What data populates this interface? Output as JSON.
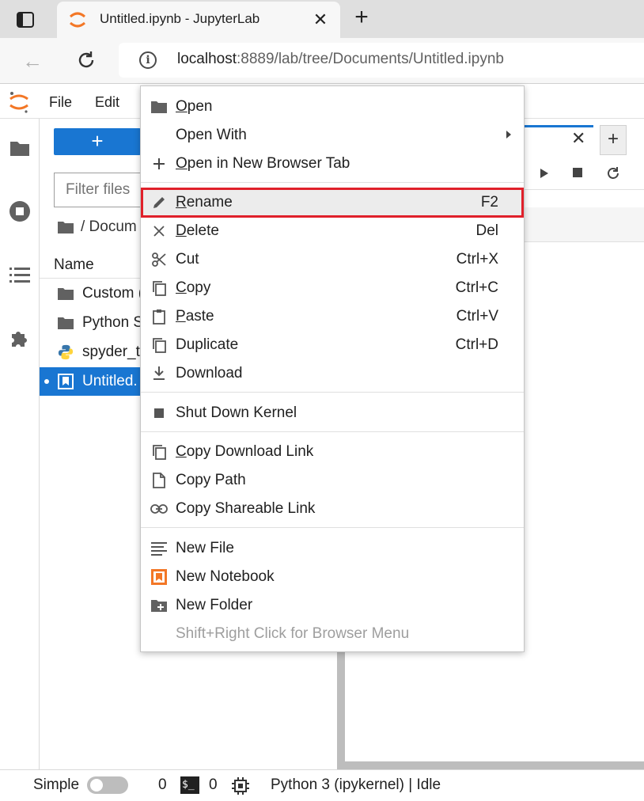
{
  "browser": {
    "tab_title": "Untitled.ipynb - JupyterLab",
    "tab_close": "✕",
    "new_tab": "+",
    "url_host": "localhost",
    "url_rest": ":8889/lab/tree/Documents/Untitled.ipynb",
    "back_label": "←"
  },
  "menubar": {
    "items": [
      "File",
      "Edit"
    ]
  },
  "filebrowser": {
    "new_button": "+",
    "filter_placeholder": "Filter files",
    "breadcrumb": "/ Docum",
    "column_name": "Name",
    "files": [
      {
        "name": "Custom (",
        "icon": "folder-icon"
      },
      {
        "name": "Python S",
        "icon": "folder-icon"
      },
      {
        "name": "spyder_t",
        "icon": "python-file-icon"
      },
      {
        "name": "Untitled.",
        "icon": "notebook-icon",
        "selected": true
      }
    ]
  },
  "dock": {
    "tab_close": "✕",
    "add": "+"
  },
  "context_menu": {
    "items": [
      {
        "icon": "folder-icon",
        "pre": "",
        "u": "O",
        "post": "pen",
        "shortcut": ""
      },
      {
        "icon": "",
        "pre": "Open With",
        "u": "",
        "post": "",
        "shortcut": "",
        "submenu": true
      },
      {
        "icon": "plus-icon",
        "pre": "",
        "u": "O",
        "post": "pen in New Browser Tab",
        "shortcut": ""
      },
      {
        "icon": "pencil-icon",
        "pre": "",
        "u": "R",
        "post": "ename",
        "shortcut": "F2"
      },
      {
        "icon": "close-icon",
        "pre": "",
        "u": "D",
        "post": "elete",
        "shortcut": "Del"
      },
      {
        "icon": "scissors-icon",
        "pre": "Cut",
        "u": "",
        "post": "",
        "shortcut": "Ctrl+X"
      },
      {
        "icon": "copy-icon",
        "pre": "",
        "u": "C",
        "post": "opy",
        "shortcut": "Ctrl+C"
      },
      {
        "icon": "paste-icon",
        "pre": "",
        "u": "P",
        "post": "aste",
        "shortcut": "Ctrl+V"
      },
      {
        "icon": "duplicate-icon",
        "pre": "Duplicate",
        "u": "",
        "post": "",
        "shortcut": "Ctrl+D"
      },
      {
        "icon": "download-icon",
        "pre": "Download",
        "u": "",
        "post": "",
        "shortcut": ""
      },
      {
        "icon": "stop-icon",
        "pre": "Shut Down Kernel",
        "u": "",
        "post": "",
        "shortcut": ""
      },
      {
        "icon": "copy-icon",
        "pre": "",
        "u": "C",
        "post": "opy Download Link",
        "shortcut": ""
      },
      {
        "icon": "file-icon",
        "pre": "Copy Path",
        "u": "",
        "post": "",
        "shortcut": ""
      },
      {
        "icon": "link-icon",
        "pre": "Copy Shareable Link",
        "u": "",
        "post": "",
        "shortcut": ""
      },
      {
        "icon": "text-file-icon",
        "pre": "New File",
        "u": "",
        "post": "",
        "shortcut": ""
      },
      {
        "icon": "notebook-icon",
        "pre": "New Notebook",
        "u": "",
        "post": "",
        "shortcut": ""
      },
      {
        "icon": "new-folder-icon",
        "pre": "New Folder",
        "u": "",
        "post": "",
        "shortcut": ""
      },
      {
        "icon": "",
        "pre": "Shift+Right Click for Browser Menu",
        "u": "",
        "post": "",
        "shortcut": "",
        "disabled": true
      }
    ]
  },
  "statusbar": {
    "mode": "Simple",
    "kernels_count": "0",
    "terminal_label": "$_",
    "terminals_count": "0",
    "kernel_status": "Python 3 (ipykernel) | Idle"
  },
  "colors": {
    "accent": "#1976d2",
    "jupyter_orange": "#f37726",
    "highlight": "#e0202a"
  }
}
